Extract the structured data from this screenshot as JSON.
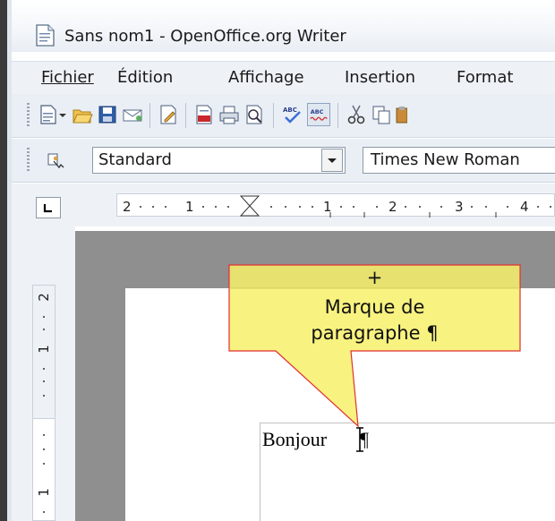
{
  "window": {
    "title": "Sans nom1 - OpenOffice.org Writer"
  },
  "menu": {
    "items": [
      {
        "label": "Fichier",
        "accel": "F"
      },
      {
        "label": "Édition",
        "accel": "d"
      },
      {
        "label": "Affichage",
        "accel": "A"
      },
      {
        "label": "Insertion",
        "accel": "I"
      },
      {
        "label": "Format",
        "accel": "t"
      }
    ]
  },
  "toolbar": {
    "icons": [
      "new-document-icon",
      "dropdown-arrow-icon",
      "open-folder-icon",
      "save-icon",
      "email-icon",
      "edit-file-icon",
      "export-pdf-icon",
      "print-icon",
      "page-preview-icon",
      "spellcheck-icon",
      "autospellcheck-icon",
      "cut-icon",
      "copy-icon",
      "paste-icon"
    ]
  },
  "format_toolbar": {
    "style_value": "Standard",
    "font_value": "Times New Roman"
  },
  "ruler": {
    "h_ticks": [
      "2",
      "1",
      "1",
      "2",
      "3",
      "4"
    ],
    "v_ticks": [
      "2",
      "1",
      "1"
    ]
  },
  "document": {
    "text": "Bonjour",
    "pilcrow": "¶"
  },
  "callout": {
    "plus": "+",
    "line1": "Marque  de",
    "line2": "paragraphe ¶"
  },
  "colors": {
    "callout_fill": "#f7f06a",
    "callout_stroke": "#e03030",
    "workspace": "#8f8f8f"
  }
}
